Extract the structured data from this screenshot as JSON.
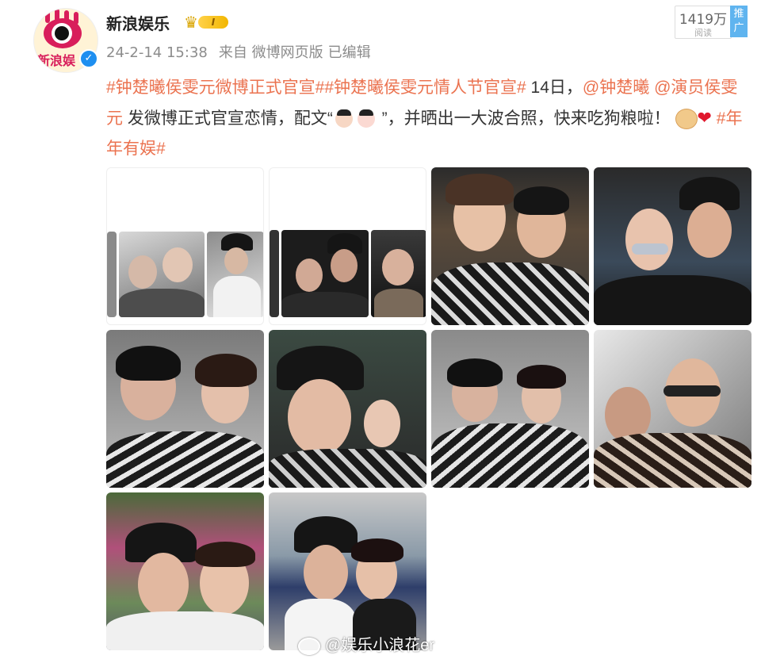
{
  "author": {
    "name": "新浪娱乐",
    "avatar_text": "新浪娱",
    "verified_icon": "verified-check-icon",
    "vip_icon": "crown-icon",
    "vip_level": "I"
  },
  "post": {
    "time": "24-2-14 15:38",
    "source": "来自 微博网页版",
    "edited": "已编辑",
    "read_count": "1419万",
    "read_label": "阅读",
    "promote": "推广",
    "text": {
      "tag1": "#钟楚曦侯雯元微博正式官宣#",
      "tag2": "#钟楚曦侯雯元情人节官宣#",
      "plain1": " 14日，",
      "mention1": "@钟楚曦",
      "mention2": " @演员侯雯元",
      "plain2": " 发微博正式官宣恋情，配文“",
      "plain3": " ”，并晒出一大波合照，快来吃狗粮啦！",
      "tag3": "#年年有娱#",
      "emoji_names": [
        "man-emoji",
        "woman-emoji",
        "doge-emoji",
        "heart-emoji"
      ]
    }
  },
  "images": {
    "count": 10,
    "watermark": "@娱乐小浪花er"
  },
  "colors": {
    "link": "#eb7350",
    "promote_bg": "#5fb4ef",
    "verified": "#1e8ff0",
    "text": "#333333",
    "meta": "#8c8c8c"
  }
}
